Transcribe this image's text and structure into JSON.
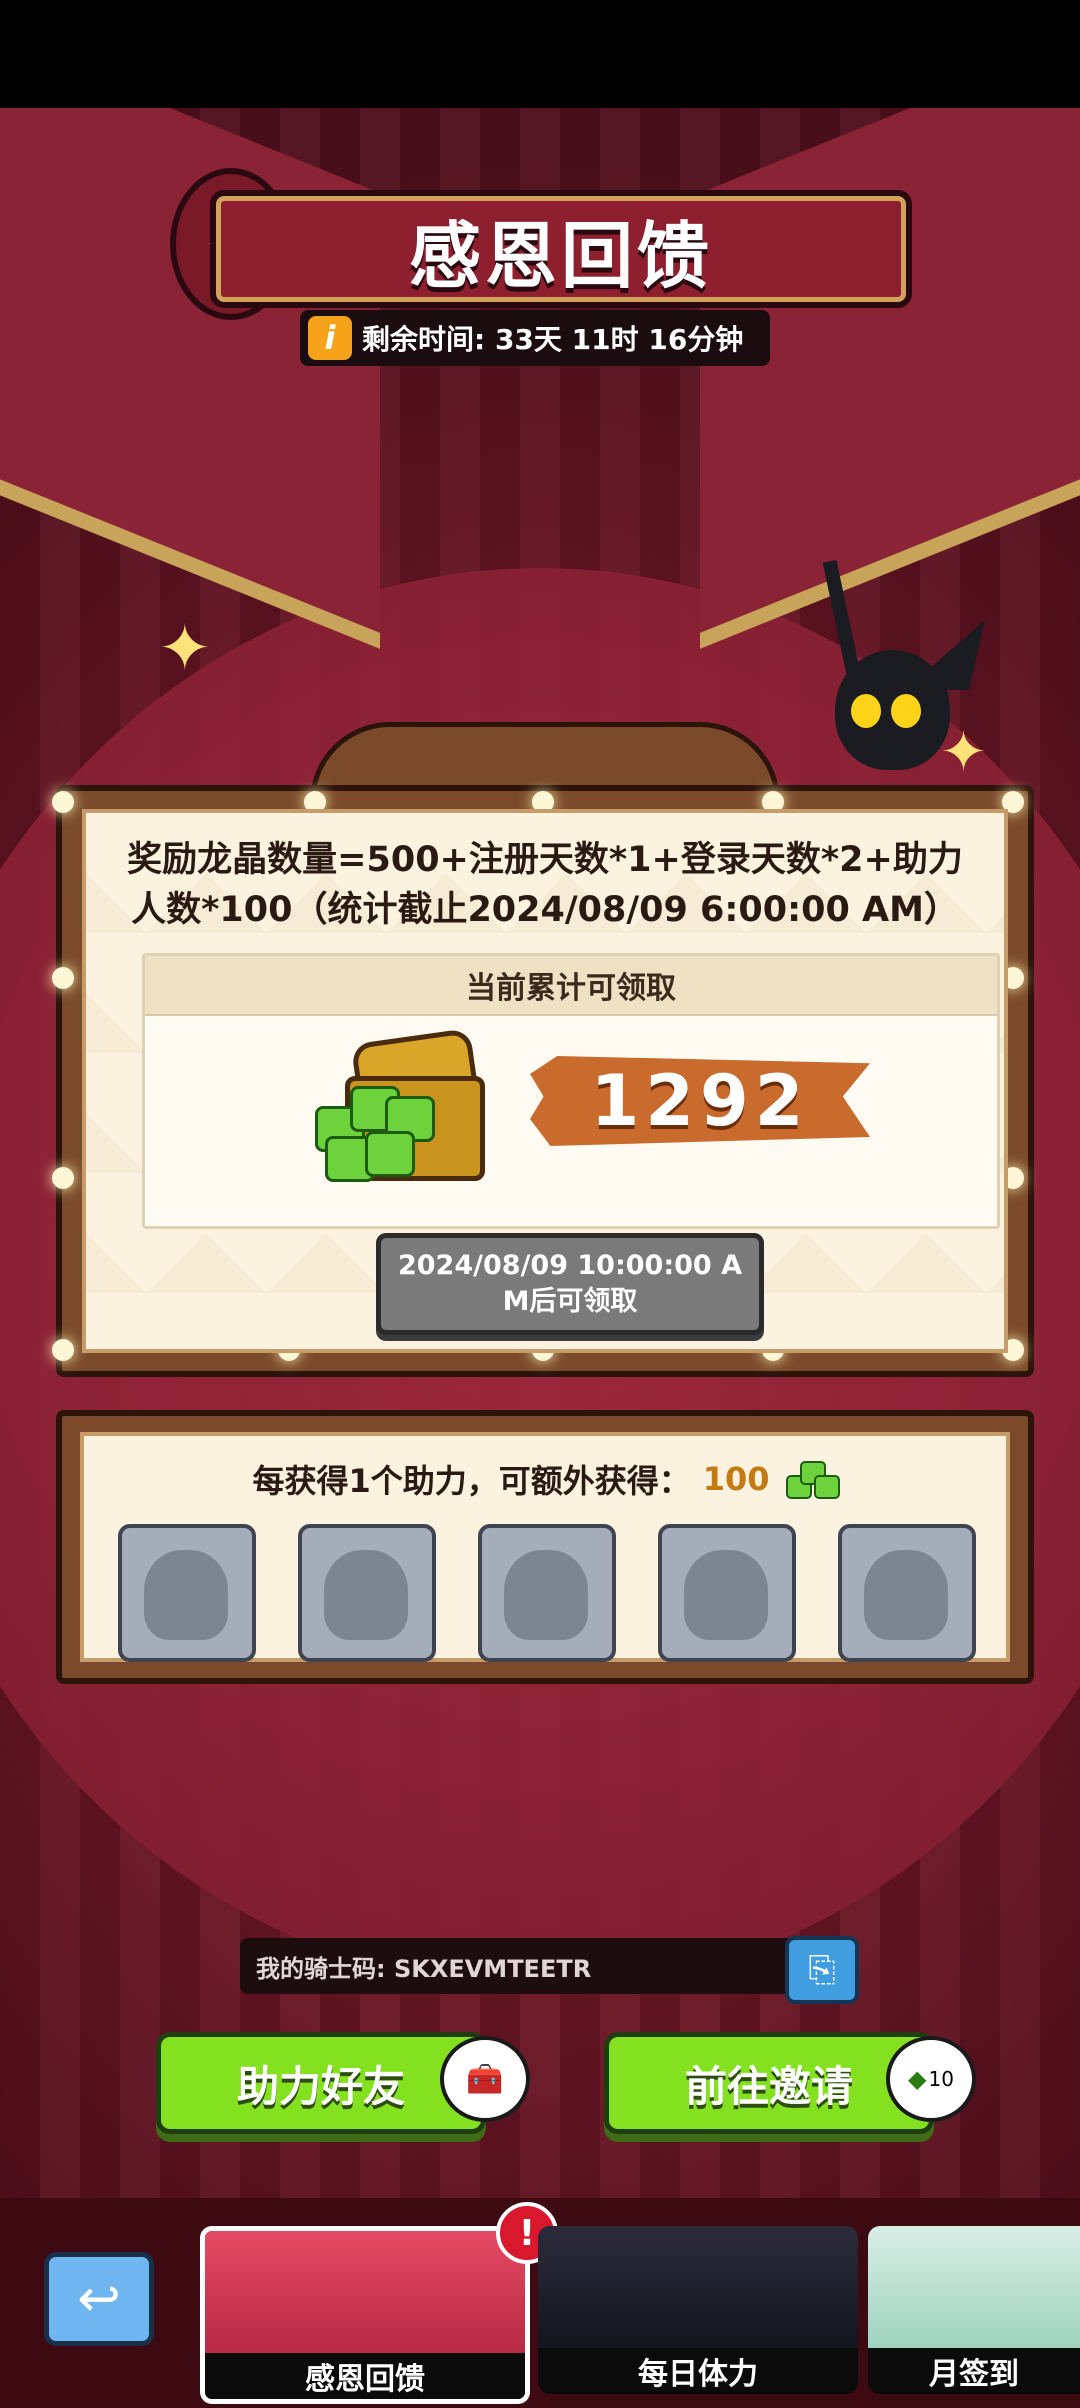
{
  "event": {
    "title": "感恩回馈",
    "time_label": "剩余时间: 33天 11时 16分钟"
  },
  "formula": {
    "line1": "奖励龙晶数量=500+注册天数*1+登录天数*2+助力",
    "line2": "人数*100（统计截止2024/08/09 6:00:00 AM）"
  },
  "accumulated": {
    "header": "当前累计可领取",
    "amount": "1292"
  },
  "claim": {
    "line1": "2024/08/09 10:00:00 A",
    "line2": "M后可领取"
  },
  "helpers": {
    "text": "每获得1个助力，可额外获得：",
    "bonus": "100",
    "slots": 5
  },
  "knight_code": {
    "label": "我的骑士码: SKXEVMTEETR"
  },
  "buttons": {
    "help_friend": "助力好友",
    "go_invite": "前往邀请",
    "invite_badge": "10"
  },
  "tabs": [
    {
      "label": "感恩回馈",
      "active": true
    },
    {
      "label": "每日体力",
      "active": false
    },
    {
      "label": "月签到",
      "active": false
    }
  ],
  "colors": {
    "green_button": "#84e11f",
    "accent_orange": "#c86b2d",
    "alert_red": "#d9182e"
  }
}
